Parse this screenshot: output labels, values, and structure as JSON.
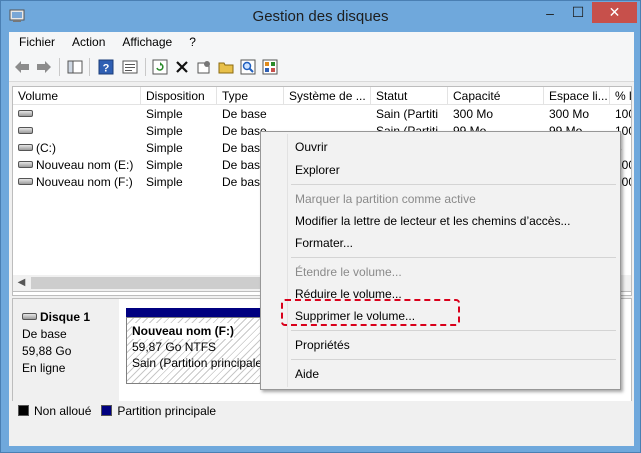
{
  "window": {
    "title": "Gestion des disques",
    "controls": {
      "minimize": "–",
      "maximize": "☐",
      "close": "✕"
    },
    "accent": "#6fa8dc",
    "close_color": "#c7504b"
  },
  "menubar": {
    "items": [
      "Fichier",
      "Action",
      "Affichage",
      "?"
    ]
  },
  "toolbar": {
    "icons": [
      "back-icon",
      "forward-icon",
      "console-tree-icon",
      "help-icon",
      "properties-icon",
      "refresh-icon",
      "delete-icon",
      "settings-icon",
      "open-folder-icon",
      "search-icon",
      "export-icon"
    ]
  },
  "volumes": {
    "headers": [
      "Volume",
      "Disposition",
      "Type",
      "Système de ...",
      "Statut",
      "Capacité",
      "Espace li...",
      "% l"
    ],
    "rows": [
      {
        "volume": "",
        "disposition": "Simple",
        "type": "De base",
        "fs": "",
        "statut": "Sain (Partiti",
        "capacite": "300 Mo",
        "espace": "300 Mo",
        "pct": "100"
      },
      {
        "volume": "",
        "disposition": "Simple",
        "type": "De base",
        "fs": "",
        "statut": "Sain (Partiti",
        "capacite": "99 Mo",
        "espace": "99 Mo",
        "pct": "100"
      },
      {
        "volume": "(C:)",
        "disposition": "Simple",
        "type": "De base",
        "fs": "",
        "statut": "",
        "capacite": "",
        "espace": "",
        "pct": "8"
      },
      {
        "volume": "Nouveau nom (E:)",
        "disposition": "Simple",
        "type": "De base",
        "fs": "",
        "statut": "",
        "capacite": "",
        "espace": "",
        "pct": "100"
      },
      {
        "volume": "Nouveau nom (F:)",
        "disposition": "Simple",
        "type": "De base",
        "fs": "",
        "statut": "",
        "capacite": "",
        "espace": "",
        "pct": "100"
      }
    ]
  },
  "disk": {
    "title": "Disque 1",
    "type": "De base",
    "size": "59,88 Go",
    "status": "En ligne",
    "partition": {
      "name": "Nouveau nom  (F:)",
      "size_fs": "59,87 Go NTFS",
      "state": "Sain (Partition principale)"
    }
  },
  "legend": {
    "unallocated": "Non alloué",
    "primary": "Partition principale",
    "primary_color": "#000080"
  },
  "context_menu": {
    "items": [
      {
        "label": "Ouvrir",
        "disabled": false
      },
      {
        "label": "Explorer",
        "disabled": false
      },
      {
        "label": "Marquer la partition comme active",
        "disabled": true
      },
      {
        "label": "Modifier la lettre de lecteur et les chemins d’accès...",
        "disabled": false
      },
      {
        "label": "Formater...",
        "disabled": false
      },
      {
        "label": "Étendre le volume...",
        "disabled": true
      },
      {
        "label": "Réduire le volume...",
        "disabled": false
      },
      {
        "label": "Supprimer le volume...",
        "disabled": false
      },
      {
        "label": "Propriétés",
        "disabled": false
      },
      {
        "label": "Aide",
        "disabled": false
      }
    ],
    "highlight_color": "#d9001b"
  }
}
